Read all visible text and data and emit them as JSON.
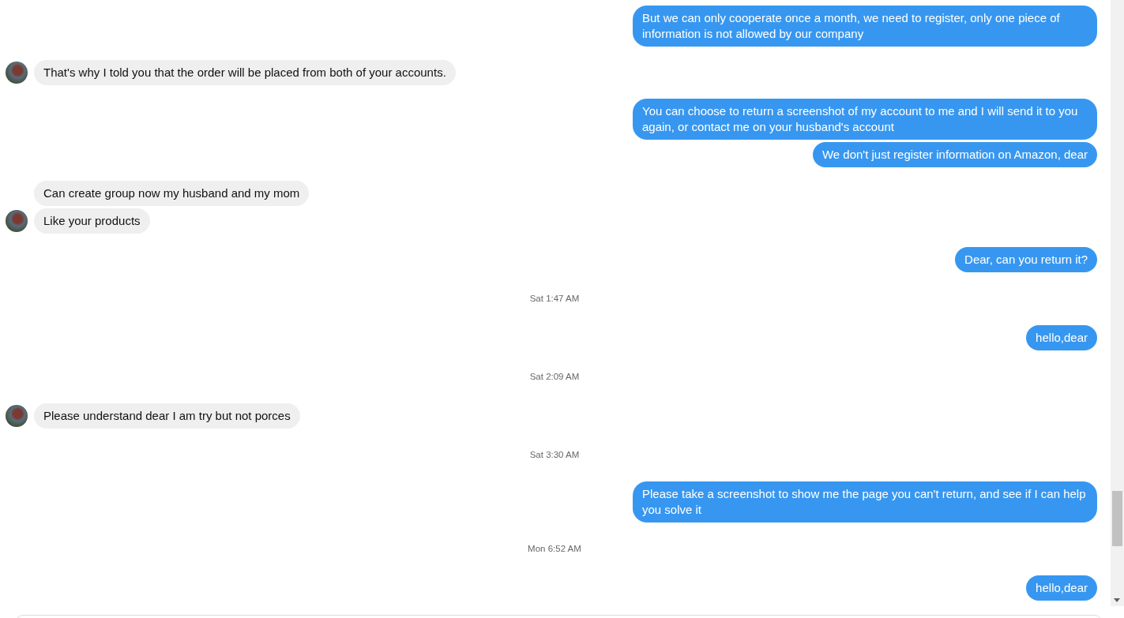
{
  "messages": [
    {
      "kind": "sent",
      "text": "But we can only cooperate once a month, we need to register, only one piece of information is not allowed by our company"
    },
    {
      "kind": "received",
      "avatar": true,
      "text": "That's why I told you that the order will be placed from both of your accounts."
    },
    {
      "kind": "sent",
      "text": "You can choose to return a screenshot of my account to me and I will send it to you again, or contact me on your husband's account"
    },
    {
      "kind": "sent",
      "text": "We don't just register information on Amazon, dear"
    },
    {
      "kind": "received",
      "avatar": false,
      "text": "Can create group now my husband and my mom"
    },
    {
      "kind": "received",
      "avatar": true,
      "text": "Like your products"
    },
    {
      "kind": "sent",
      "text": "Dear, can you return it?"
    },
    {
      "kind": "timestamp",
      "text": "Sat 1:47 AM"
    },
    {
      "kind": "sent",
      "text": "hello,dear"
    },
    {
      "kind": "timestamp",
      "text": "Sat 2:09 AM"
    },
    {
      "kind": "received",
      "avatar": true,
      "text": "Please understand dear I am try but not porces"
    },
    {
      "kind": "timestamp",
      "text": "Sat 3:30 AM"
    },
    {
      "kind": "sent",
      "text": "Please take a screenshot to show me the page you can't return, and see if I can help you solve it"
    },
    {
      "kind": "timestamp",
      "text": "Mon 6:52 AM"
    },
    {
      "kind": "sent",
      "text": "hello,dear"
    }
  ]
}
